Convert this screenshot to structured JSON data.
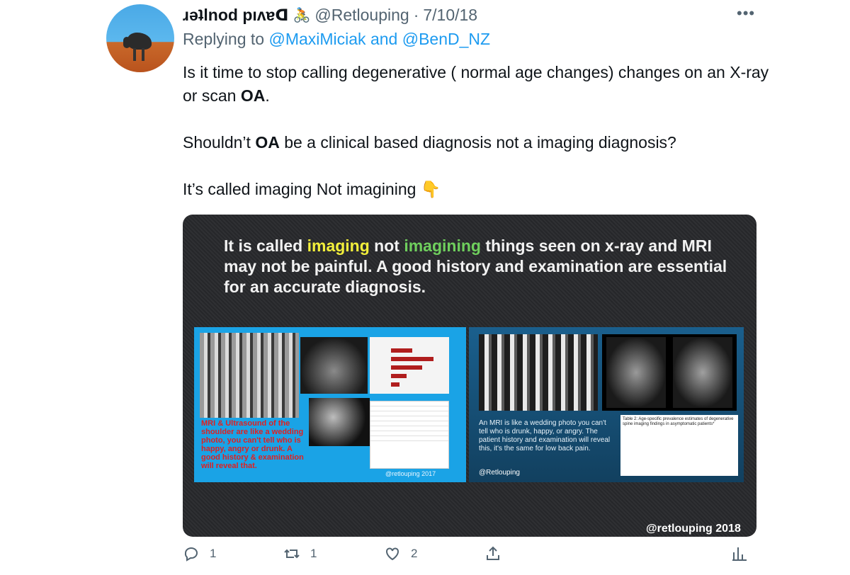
{
  "tweet": {
    "author_display_name": "ɹǝʇlnod pıʌɐᗡ",
    "author_emoji": "🚴",
    "handle": "@Retlouping",
    "separator": "·",
    "date": "7/10/18",
    "more_label": "•••",
    "replying_prefix": "Replying to",
    "replying_user_1": "@MaxiMiciak",
    "replying_and": "and",
    "replying_user_2": "@BenD_NZ",
    "body": {
      "p1_before": "Is it time to stop calling degenerative ( normal age changes) changes on an X-ray or scan ",
      "p1_bold": "OA",
      "p1_after": ".",
      "p2_before": "Shouldn’t ",
      "p2_bold": "OA",
      "p2_after": " be a clinical based diagnosis not a imaging diagnosis?",
      "p3_text": "It’s called imaging Not imagining ",
      "p3_emoji": "👇"
    }
  },
  "media": {
    "title_part1": "It is called ",
    "title_hl1": "imaging",
    "title_part2": " not ",
    "title_hl2": "imagining",
    "title_part3": " things seen on x-ray and MRI may not be painful. A good history and examination are essential for an accurate diagnosis.",
    "left_caption": "MRI & Ultrasound of the shoulder are like a wedding photo, you can't tell who is happy, angry or drunk. A good history & examination will reveal that.",
    "left_credit": "@retlouping 2017",
    "right_caption": "An MRI is like a wedding  photo you can't tell who is drunk, happy, or angry. The patient history and examination will reveal this, it's the same for low back pain.",
    "right_credit": "@Retlouping",
    "table_title": "Table 2: Age-specific prevalence estimates of degenerative spine imaging findings in asymptomatic patients*",
    "watermark": "@retlouping 2018"
  },
  "actions": {
    "reply_count": "1",
    "retweet_count": "1",
    "like_count": "2",
    "colors": {
      "muted": "#536471",
      "link": "#1d9bf0"
    }
  }
}
